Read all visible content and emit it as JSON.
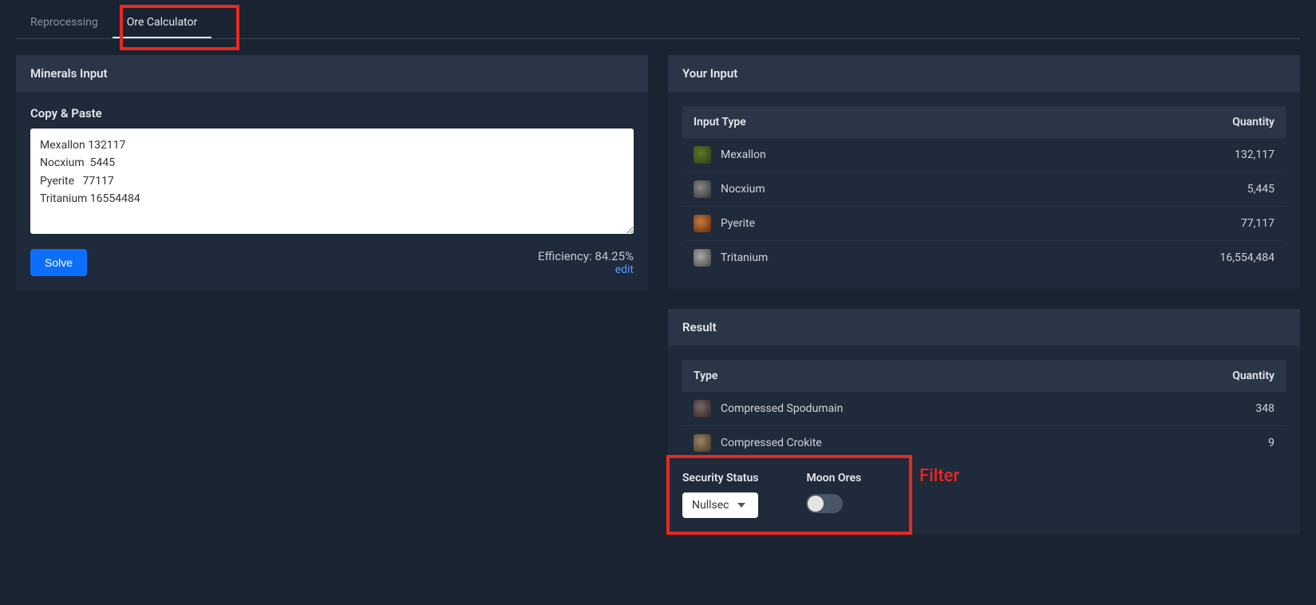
{
  "tabs": {
    "reprocessing": "Reprocessing",
    "ore_calculator": "Ore Calculator"
  },
  "left_panel": {
    "header": "Minerals Input",
    "copy_paste_label": "Copy & Paste",
    "textarea_value": "Mexallon 132117\nNocxium  5445\nPyerite   77117\nTritanium 16554484",
    "solve_button": "Solve",
    "efficiency_text": "Efficiency: 84.25%",
    "edit_link": "edit"
  },
  "your_input": {
    "header": "Your Input",
    "col_type": "Input Type",
    "col_qty": "Quantity",
    "rows": [
      {
        "name": "Mexallon",
        "qty": "132,117"
      },
      {
        "name": "Nocxium",
        "qty": "5,445"
      },
      {
        "name": "Pyerite",
        "qty": "77,117"
      },
      {
        "name": "Tritanium",
        "qty": "16,554,484"
      }
    ]
  },
  "result": {
    "header": "Result",
    "col_type": "Type",
    "col_qty": "Quantity",
    "rows": [
      {
        "name": "Compressed Spodumain",
        "qty": "348"
      },
      {
        "name": "Compressed Crokite",
        "qty": "9"
      }
    ],
    "filters": {
      "security_label": "Security Status",
      "security_value": "Nullsec",
      "moon_label": "Moon Ores"
    }
  },
  "annotation": {
    "filter_label": "Filter"
  }
}
